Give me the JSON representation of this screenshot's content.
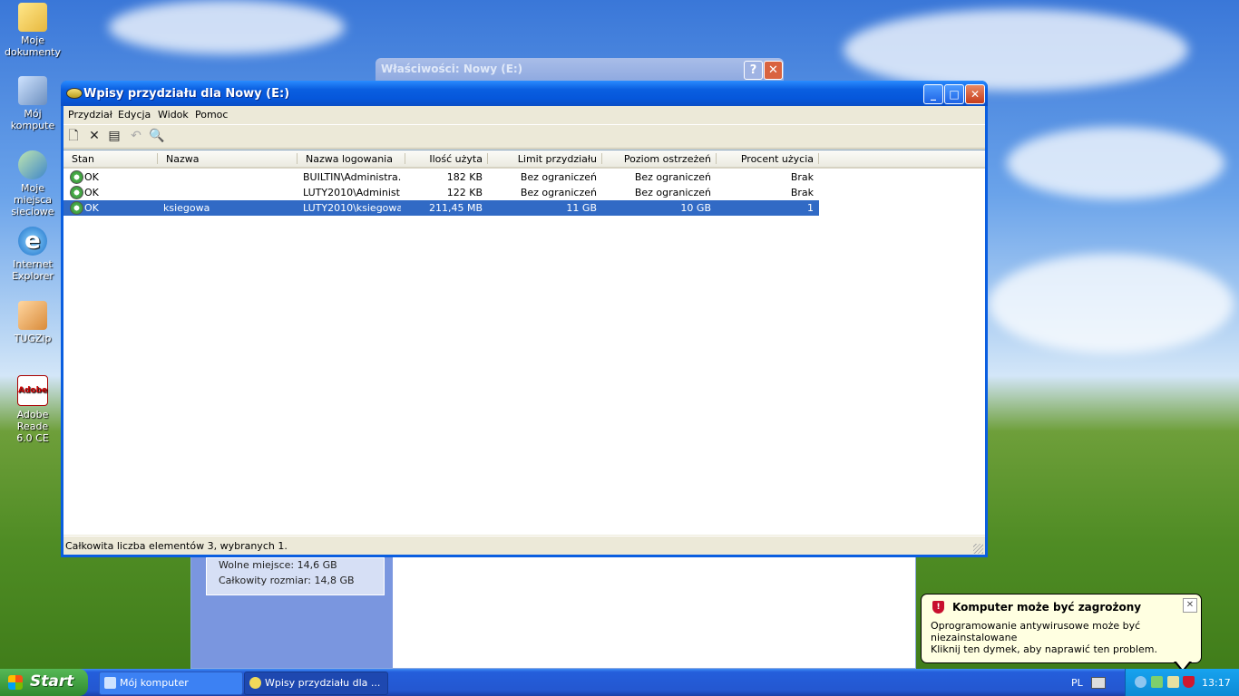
{
  "desktop": {
    "icons": [
      {
        "label1": "Moje",
        "label2": "dokumenty",
        "icon": "my-documents-icon"
      },
      {
        "label1": "Mój kompute",
        "label2": "",
        "icon": "my-computer-icon"
      },
      {
        "label1": "Moje miejsca",
        "label2": "sieciowe",
        "icon": "network-places-icon"
      },
      {
        "label1": "Internet",
        "label2": "Explorer",
        "icon": "internet-explorer-icon"
      },
      {
        "label1": "TUGZip",
        "label2": "",
        "icon": "tugzip-icon"
      },
      {
        "label1": "Adobe Reade",
        "label2": "6.0 CE",
        "icon": "adobe-reader-icon"
      }
    ]
  },
  "background_window": {
    "title": "Właściwości: Nowy (E:)",
    "help_label": "?",
    "close_label": "✕",
    "free_space": "Wolne miejsce: 14,6 GB",
    "total_size": "Całkowity rozmiar: 14,8 GB"
  },
  "window": {
    "title": "Wpisy przydziału dla Nowy (E:)",
    "minimize": "_",
    "maximize": "□",
    "close": "✕",
    "menu": [
      "Przydział",
      "Edycja",
      "Widok",
      "Pomoc"
    ],
    "toolbar": [
      {
        "name": "new-entry-icon",
        "glyph": "🗋"
      },
      {
        "name": "delete-icon",
        "glyph": "✕"
      },
      {
        "name": "properties-icon",
        "glyph": "▤"
      },
      {
        "name": "undo-icon",
        "glyph": "↶"
      },
      {
        "name": "find-icon",
        "glyph": "🔍"
      }
    ],
    "columns": [
      "Stan",
      "Nazwa",
      "Nazwa logowania",
      "Ilość użyta",
      "Limit przydziału",
      "Poziom ostrzeżeń",
      "Procent użycia"
    ],
    "rows": [
      {
        "status": "OK",
        "name": "",
        "login": "BUILTIN\\Administra...",
        "used": "182 KB",
        "limit": "Bez ograniczeń",
        "warn": "Bez ograniczeń",
        "percent": "Brak",
        "selected": false
      },
      {
        "status": "OK",
        "name": "",
        "login": "LUTY2010\\Administ...",
        "used": "122 KB",
        "limit": "Bez ograniczeń",
        "warn": "Bez ograniczeń",
        "percent": "Brak",
        "selected": false
      },
      {
        "status": "OK",
        "name": "ksiegowa",
        "login": "LUTY2010\\ksiegowa",
        "used": "211,45 MB",
        "limit": "11 GB",
        "warn": "10 GB",
        "percent": "1",
        "selected": true
      }
    ],
    "status_text": "Całkowita liczba elementów 3, wybranych 1."
  },
  "balloon": {
    "title": "Komputer może być zagrożony",
    "line1": "Oprogramowanie antywirusowe może być niezainstalowane",
    "line2": "Kliknij ten dymek, aby naprawić ten problem.",
    "close": "✕"
  },
  "taskbar": {
    "start_label": "Start",
    "tasks": [
      "Mój komputer",
      "Wpisy przydziału dla ..."
    ],
    "language": "PL",
    "clock": "13:17"
  }
}
